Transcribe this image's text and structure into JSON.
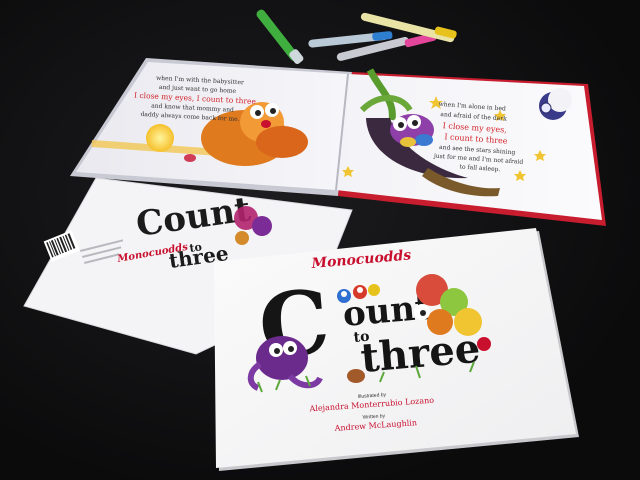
{
  "open_book": {
    "left_page_lines": [
      "when I'm with the babysitter",
      "and just want to go home",
      "I close my eyes, I count to three",
      "and know that mommy and",
      "daddy always come back for me."
    ],
    "right_page_lines": [
      "when I'm alone in bed",
      "and afraid of the dark",
      "I close my eyes,",
      "I count to three",
      "and see the stars shining",
      "just for me and I'm not afraid",
      "to fall asleep."
    ],
    "highlight_color": "#d2232a"
  },
  "back_cover": {
    "publisher": "Monocuodds",
    "title_line1": "Count",
    "title_line2": "to",
    "title_line3": "three"
  },
  "front_cover": {
    "publisher": "Monocuodds",
    "title_c": "C",
    "title_ount": "ount",
    "title_to": "to",
    "title_three": "three",
    "illustrated_by_label": "Illustrated by",
    "illustrator": "Alejandra Monterrubio Lozano",
    "written_by_label": "Written by",
    "author": "Andrew McLaughlin",
    "accent_color": "#c8102e"
  },
  "markers": [
    "green-marker",
    "blue-marker",
    "pink-marker",
    "yellow-marker"
  ]
}
